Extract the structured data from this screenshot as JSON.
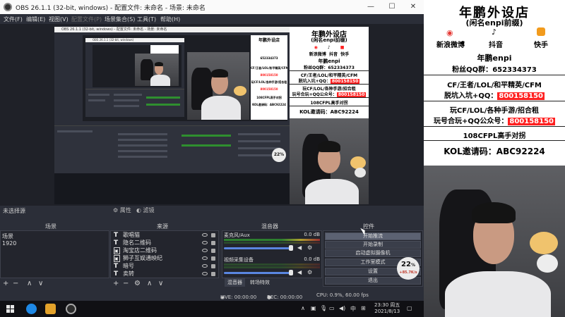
{
  "window": {
    "title": "OBS 26.1.1 (32-bit, windows) - 配置文件: 未命名 - 场景: 未命名",
    "minimize": "—",
    "maximize": "☐",
    "close": "✕"
  },
  "menu": [
    "文件(F)",
    "编辑(E)",
    "视图(V)",
    "配置文件(P)",
    "场景集合(S)",
    "工具(T)",
    "帮助(H)"
  ],
  "nested": {
    "title": "OBS 26.1.1 (32-bit, windows) - 配置文件: 未命名 - 场景: 未命名",
    "title2": "OBS 26.1.1 (32-bit, windows)",
    "status": "LIVE: 00:00:00  REC: 00:00:00  CPU: 0.9%, 60.00 fps"
  },
  "poster": {
    "title": "年鹏外设店",
    "subtitle": "(闲名enpi前缀)",
    "weibo": "新浪微博",
    "douyin": "抖音",
    "kuaishou": "快手",
    "name": "年鹏enpi",
    "qq_label": "粉丝QQ群：",
    "qq_number": "652334373",
    "line1": "CF/王者/LOL/和平精英/CFM",
    "line2_pre": "脱坑入坑+QQ：",
    "line2_num": "800158150",
    "line3": "玩CF/LOL/各种手游/招合租",
    "line4_pre": "玩号合玩+QQ公众号：",
    "line4_num": "800158150",
    "line5": "108CFPL高手对拐",
    "line6": "KOL邀请码：ABC92224"
  },
  "docks": {
    "no_source": "未选择源",
    "properties": "属性",
    "filters": "滤镜",
    "scenes_header": "场景",
    "sources_header": "来源",
    "mixer_header": "混音器",
    "controls_header": "控件"
  },
  "scenes": [
    "场景",
    "1920"
  ],
  "sources": [
    "歌唱猫",
    "隐名二维码",
    "淘宝店二维码",
    "狮子互娱通映纪",
    "暗号",
    "卖转"
  ],
  "mixer": {
    "ch1_name": "麦克风/Aux",
    "ch1_db": "0.0 dB",
    "ch2_name": "视频采集设备",
    "ch2_db": "0.0 dB",
    "tab_mixer": "混音器",
    "tab_transitions": "转场特效"
  },
  "controls": [
    "开始推流",
    "开始录制",
    "启动虚拟摄像机",
    "工作室模式",
    "设置",
    "退出"
  ],
  "badge": {
    "percent": "22",
    "unit": "%",
    "rate": "+85.7K/s"
  },
  "status": {
    "live": "LIVE: 00:00:00",
    "rec": "REC: 00:00:00",
    "cpu": "CPU: 0.9%, 60.00 fps"
  },
  "taskbar": {
    "ime": "中",
    "clock_time": "23:30 周五",
    "clock_date": "2021/8/13"
  },
  "colors": {
    "accent": "#ff2020",
    "obs_bg": "#2b2e38",
    "dock_bg": "#23252d"
  }
}
